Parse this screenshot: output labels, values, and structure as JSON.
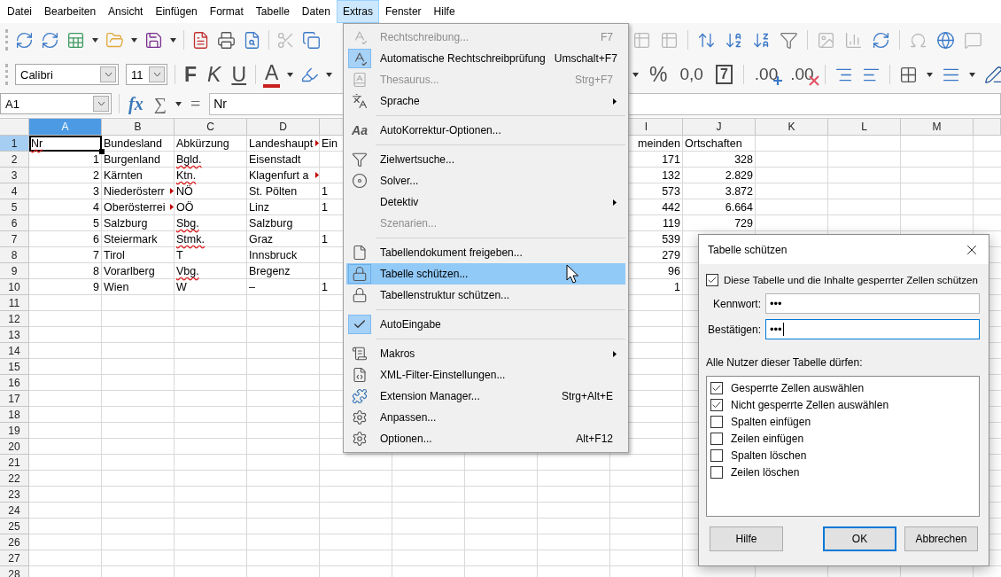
{
  "menubar": [
    {
      "label": "Datei",
      "selected": false
    },
    {
      "label": "Bearbeiten",
      "selected": false
    },
    {
      "label": "Ansicht",
      "selected": false
    },
    {
      "label": "Einfügen",
      "selected": false
    },
    {
      "label": "Format",
      "selected": false
    },
    {
      "label": "Tabelle",
      "selected": false
    },
    {
      "label": "Daten",
      "selected": false
    },
    {
      "label": "Extras",
      "selected": true
    },
    {
      "label": "Fenster",
      "selected": false
    },
    {
      "label": "Hilfe",
      "selected": false
    }
  ],
  "format_toolbar": {
    "font_name": "Calibri",
    "font_size": "11",
    "text_buttons": [
      {
        "label": "F",
        "kind": "bold"
      },
      {
        "label": "K",
        "kind": "italic"
      },
      {
        "label": "U",
        "kind": "underline"
      },
      {
        "label": "A",
        "kind": "font-color"
      }
    ],
    "number_buttons": [
      {
        "label": "%",
        "kind": "percent"
      },
      {
        "label": "0,0",
        "kind": "number"
      },
      {
        "label": "7",
        "kind": "standard"
      },
      {
        "label": ".00",
        "kind": "add-decimal"
      },
      {
        "label": ".00",
        "kind": "remove-decimal"
      }
    ]
  },
  "formula_bar": {
    "name_box": "A1",
    "buttons": [
      {
        "label": "fx",
        "kind": "function"
      },
      {
        "label": "∑",
        "kind": "sum"
      },
      {
        "label": "=",
        "kind": "formula"
      }
    ],
    "content": "Nr"
  },
  "sheet": {
    "columns": [
      {
        "label": "A",
        "selected": true
      },
      {
        "label": "B",
        "selected": false
      },
      {
        "label": "C",
        "selected": false
      },
      {
        "label": "D",
        "selected": false
      },
      null,
      null,
      null,
      null,
      {
        "label": "I",
        "selected": false
      },
      {
        "label": "J",
        "selected": false
      },
      {
        "label": "K",
        "selected": false
      },
      {
        "label": "L",
        "selected": false
      },
      {
        "label": "M",
        "selected": false
      },
      null
    ],
    "rows": [
      {
        "number": "1",
        "selected": true,
        "cells": [
          {
            "text": "Nr",
            "kind": "text",
            "misspelled": true,
            "overflow": false
          },
          {
            "text": "Bundesland",
            "kind": "text",
            "misspelled": false,
            "overflow": false
          },
          {
            "text": "Abkürzung",
            "kind": "text",
            "misspelled": false,
            "overflow": false
          },
          {
            "text": "Landeshaupt",
            "kind": "text",
            "misspelled": false,
            "overflow": true
          },
          {
            "text": "Ein",
            "kind": "text",
            "misspelled": false,
            "overflow": false
          },
          null,
          null,
          null,
          {
            "text": "meinden",
            "kind": "cut",
            "misspelled": false,
            "overflow": false
          },
          {
            "text": "Ortschaften",
            "kind": "text",
            "misspelled": false,
            "overflow": false
          }
        ]
      },
      {
        "number": "2",
        "selected": false,
        "cells": [
          {
            "text": "1",
            "kind": "number",
            "misspelled": false,
            "overflow": false
          },
          {
            "text": "Burgenland",
            "kind": "text",
            "misspelled": false,
            "overflow": false
          },
          {
            "text": "Bgld.",
            "kind": "text",
            "misspelled": true,
            "overflow": false
          },
          {
            "text": "Eisenstadt",
            "kind": "text",
            "misspelled": false,
            "overflow": false
          },
          null,
          null,
          null,
          null,
          {
            "text": "171",
            "kind": "number",
            "misspelled": false,
            "overflow": false
          },
          {
            "text": "328",
            "kind": "number",
            "misspelled": false,
            "overflow": false
          }
        ]
      },
      {
        "number": "3",
        "selected": false,
        "cells": [
          {
            "text": "2",
            "kind": "number",
            "misspelled": false,
            "overflow": false
          },
          {
            "text": "Kärnten",
            "kind": "text",
            "misspelled": false,
            "overflow": false
          },
          {
            "text": "Ktn.",
            "kind": "text",
            "misspelled": true,
            "overflow": false
          },
          {
            "text": "Klagenfurt a",
            "kind": "text",
            "misspelled": false,
            "overflow": true
          },
          null,
          null,
          null,
          null,
          {
            "text": "132",
            "kind": "number",
            "misspelled": false,
            "overflow": false
          },
          {
            "text": "2.829",
            "kind": "number",
            "misspelled": false,
            "overflow": false
          }
        ]
      },
      {
        "number": "4",
        "selected": false,
        "cells": [
          {
            "text": "3",
            "kind": "number",
            "misspelled": false,
            "overflow": false
          },
          {
            "text": "Niederösterr",
            "kind": "text",
            "misspelled": false,
            "overflow": true
          },
          {
            "text": "NÖ",
            "kind": "text",
            "misspelled": false,
            "overflow": false
          },
          {
            "text": "St. Pölten",
            "kind": "text",
            "misspelled": false,
            "overflow": false
          },
          {
            "text": "1",
            "kind": "text",
            "misspelled": false,
            "overflow": false
          },
          null,
          null,
          null,
          {
            "text": "573",
            "kind": "number",
            "misspelled": false,
            "overflow": false
          },
          {
            "text": "3.872",
            "kind": "number",
            "misspelled": false,
            "overflow": false
          }
        ]
      },
      {
        "number": "5",
        "selected": false,
        "cells": [
          {
            "text": "4",
            "kind": "number",
            "misspelled": false,
            "overflow": false
          },
          {
            "text": "Oberösterrei",
            "kind": "text",
            "misspelled": false,
            "overflow": true
          },
          {
            "text": "OÖ",
            "kind": "text",
            "misspelled": false,
            "overflow": false
          },
          {
            "text": "Linz",
            "kind": "text",
            "misspelled": false,
            "overflow": false
          },
          {
            "text": "1",
            "kind": "text",
            "misspelled": false,
            "overflow": false
          },
          null,
          null,
          null,
          {
            "text": "442",
            "kind": "number",
            "misspelled": false,
            "overflow": false
          },
          {
            "text": "6.664",
            "kind": "number",
            "misspelled": false,
            "overflow": false
          }
        ]
      },
      {
        "number": "6",
        "selected": false,
        "cells": [
          {
            "text": "5",
            "kind": "number",
            "misspelled": false,
            "overflow": false
          },
          {
            "text": "Salzburg",
            "kind": "text",
            "misspelled": false,
            "overflow": false
          },
          {
            "text": "Sbg.",
            "kind": "text",
            "misspelled": true,
            "overflow": false
          },
          {
            "text": "Salzburg",
            "kind": "text",
            "misspelled": false,
            "overflow": false
          },
          null,
          null,
          null,
          null,
          {
            "text": "119",
            "kind": "number",
            "misspelled": false,
            "overflow": false
          },
          {
            "text": "729",
            "kind": "number",
            "misspelled": false,
            "overflow": false
          }
        ]
      },
      {
        "number": "7",
        "selected": false,
        "cells": [
          {
            "text": "6",
            "kind": "number",
            "misspelled": false,
            "overflow": false
          },
          {
            "text": "Steiermark",
            "kind": "text",
            "misspelled": false,
            "overflow": false
          },
          {
            "text": "Stmk.",
            "kind": "text",
            "misspelled": true,
            "overflow": false
          },
          {
            "text": "Graz",
            "kind": "text",
            "misspelled": false,
            "overflow": false
          },
          {
            "text": "1",
            "kind": "text",
            "misspelled": false,
            "overflow": false
          },
          null,
          null,
          null,
          {
            "text": "539",
            "kind": "number",
            "misspelled": false,
            "overflow": false
          }
        ]
      },
      {
        "number": "8",
        "selected": false,
        "cells": [
          {
            "text": "7",
            "kind": "number",
            "misspelled": false,
            "overflow": false
          },
          {
            "text": "Tirol",
            "kind": "text",
            "misspelled": false,
            "overflow": false
          },
          {
            "text": "T",
            "kind": "text",
            "misspelled": false,
            "overflow": false
          },
          {
            "text": "Innsbruck",
            "kind": "text",
            "misspelled": false,
            "overflow": false
          },
          null,
          null,
          null,
          null,
          {
            "text": "279",
            "kind": "number",
            "misspelled": false,
            "overflow": false
          }
        ]
      },
      {
        "number": "9",
        "selected": false,
        "cells": [
          {
            "text": "8",
            "kind": "number",
            "misspelled": false,
            "overflow": false
          },
          {
            "text": "Vorarlberg",
            "kind": "text",
            "misspelled": false,
            "overflow": false
          },
          {
            "text": "Vbg.",
            "kind": "text",
            "misspelled": true,
            "overflow": false
          },
          {
            "text": "Bregenz",
            "kind": "text",
            "misspelled": false,
            "overflow": false
          },
          null,
          null,
          null,
          null,
          {
            "text": "96",
            "kind": "number",
            "misspelled": false,
            "overflow": false
          }
        ]
      },
      {
        "number": "10",
        "selected": false,
        "cells": [
          {
            "text": "9",
            "kind": "number",
            "misspelled": false,
            "overflow": false
          },
          {
            "text": "Wien",
            "kind": "text",
            "misspelled": false,
            "overflow": false
          },
          {
            "text": "W",
            "kind": "text",
            "misspelled": false,
            "overflow": false
          },
          {
            "text": "–",
            "kind": "text",
            "misspelled": false,
            "overflow": false
          },
          {
            "text": "1",
            "kind": "text",
            "misspelled": false,
            "overflow": false
          },
          null,
          null,
          null,
          {
            "text": "1",
            "kind": "number",
            "misspelled": false,
            "overflow": false
          }
        ]
      },
      {
        "number": "11",
        "selected": false
      },
      {
        "number": "12",
        "selected": false
      },
      {
        "number": "13",
        "selected": false
      },
      {
        "number": "14",
        "selected": false
      },
      {
        "number": "15",
        "selected": false
      },
      {
        "number": "16",
        "selected": false
      },
      {
        "number": "17",
        "selected": false
      },
      {
        "number": "18",
        "selected": false
      },
      {
        "number": "19",
        "selected": false
      },
      {
        "number": "20",
        "selected": false
      },
      {
        "number": "21",
        "selected": false
      },
      {
        "number": "22",
        "selected": false
      },
      {
        "number": "23",
        "selected": false
      },
      {
        "number": "24",
        "selected": false
      },
      {
        "number": "25",
        "selected": false
      },
      {
        "number": "26",
        "selected": false
      },
      {
        "number": "27",
        "selected": false
      },
      {
        "number": "28",
        "selected": false
      }
    ]
  },
  "extras_menu": {
    "items": [
      {
        "kind": "item",
        "label": "Rechtschreibung...",
        "shortcut": "F7",
        "disabled": true,
        "selected": false,
        "checked": false,
        "submenu": false
      },
      {
        "kind": "item",
        "label": "Automatische Rechtschreibprüfung",
        "shortcut": "Umschalt+F7",
        "disabled": false,
        "selected": false,
        "checked": true,
        "submenu": false
      },
      {
        "kind": "item",
        "label": "Thesaurus...",
        "shortcut": "Strg+F7",
        "disabled": true,
        "selected": false,
        "checked": false,
        "submenu": false
      },
      {
        "kind": "item",
        "label": "Sprache",
        "disabled": false,
        "selected": false,
        "checked": false,
        "submenu": true
      },
      {
        "kind": "separator"
      },
      {
        "kind": "item",
        "label": "AutoKorrektur-Optionen...",
        "icon_text": "Aa",
        "disabled": false,
        "selected": false,
        "checked": false,
        "submenu": false
      },
      {
        "kind": "separator"
      },
      {
        "kind": "item",
        "label": "Zielwertsuche...",
        "disabled": false,
        "selected": false,
        "checked": false,
        "submenu": false
      },
      {
        "kind": "item",
        "label": "Solver...",
        "disabled": false,
        "selected": false,
        "checked": false,
        "submenu": false
      },
      {
        "kind": "item",
        "label": "Detektiv",
        "disabled": false,
        "selected": false,
        "checked": false,
        "submenu": true
      },
      {
        "kind": "item",
        "label": "Szenarien...",
        "disabled": true,
        "selected": false,
        "checked": false,
        "submenu": false
      },
      {
        "kind": "separator"
      },
      {
        "kind": "item",
        "label": "Tabellendokument freigeben...",
        "disabled": false,
        "selected": false,
        "checked": false,
        "submenu": false
      },
      {
        "kind": "item",
        "label": "Tabelle schützen...",
        "disabled": false,
        "selected": true,
        "checked": false,
        "submenu": false
      },
      {
        "kind": "item",
        "label": "Tabellenstruktur schützen...",
        "disabled": false,
        "selected": false,
        "checked": false,
        "submenu": false
      },
      {
        "kind": "separator"
      },
      {
        "kind": "item",
        "label": "AutoEingabe",
        "disabled": false,
        "selected": false,
        "checked": true,
        "submenu": false
      },
      {
        "kind": "separator"
      },
      {
        "kind": "item",
        "label": "Makros",
        "disabled": false,
        "selected": false,
        "checked": false,
        "submenu": true
      },
      {
        "kind": "item",
        "label": "XML-Filter-Einstellungen...",
        "disabled": false,
        "selected": false,
        "checked": false,
        "submenu": false
      },
      {
        "kind": "item",
        "label": "Extension Manager...",
        "shortcut": "Strg+Alt+E",
        "disabled": false,
        "selected": false,
        "checked": false,
        "submenu": false
      },
      {
        "kind": "item",
        "label": "Anpassen...",
        "disabled": false,
        "selected": false,
        "checked": false,
        "submenu": false
      },
      {
        "kind": "item",
        "label": "Optionen...",
        "shortcut": "Alt+F12",
        "disabled": false,
        "selected": false,
        "checked": false,
        "submenu": false
      }
    ]
  },
  "dialog": {
    "title": "Tabelle schützen",
    "protect": {
      "label": "Diese Tabelle und die Inhalte gesperrter Zellen schützen",
      "checked": true
    },
    "fields": [
      {
        "label": "Kennwort:",
        "value": "•••",
        "focused": false
      },
      {
        "label": "Bestätigen:",
        "value": "•••",
        "focused": true
      }
    ],
    "permissions_label": "Alle Nutzer dieser Tabelle dürfen:",
    "permissions": [
      {
        "label": "Gesperrte Zellen auswählen",
        "checked": true
      },
      {
        "label": "Nicht gesperrte Zellen auswählen",
        "checked": true
      },
      {
        "label": "Spalten einfügen",
        "checked": false
      },
      {
        "label": "Zeilen einfügen",
        "checked": false
      },
      {
        "label": "Spalten löschen",
        "checked": false
      },
      {
        "label": "Zeilen löschen",
        "checked": false
      }
    ],
    "buttons": [
      {
        "label": "Hilfe",
        "default": false
      },
      {
        "label": "OK",
        "default": true
      },
      {
        "label": "Abbrechen",
        "default": false
      }
    ]
  }
}
